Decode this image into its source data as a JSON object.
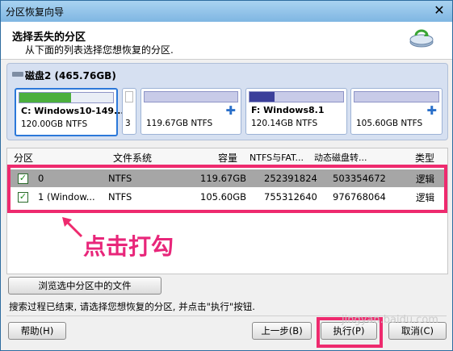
{
  "window": {
    "title": "分区恢复向导",
    "close_glyph": "✕"
  },
  "header": {
    "title": "选择丢失的分区",
    "subtitle": "从下面的列表选择您想恢复的分区."
  },
  "disk": {
    "label": "磁盘2 (465.76GB)",
    "partitions": [
      {
        "name": "C: Windows10-149...",
        "size": "120.00GB NTFS",
        "fill_fraction": 0.55,
        "fill_color": "#4caf3e",
        "selected": true
      },
      {
        "name": "",
        "size": "3",
        "fill_fraction": 0,
        "fill_color": "#ffffff",
        "selected": false
      },
      {
        "name": "",
        "size": "119.67GB NTFS",
        "fill_fraction": 0,
        "fill_color": "#3b3f9a",
        "selected": false,
        "plus": true
      },
      {
        "name": "F: Windows8.1",
        "size": "120.14GB NTFS",
        "fill_fraction": 0.27,
        "fill_color": "#3b3f9a",
        "selected": false
      },
      {
        "name": "",
        "size": "105.60GB NTFS",
        "fill_fraction": 0,
        "fill_color": "#3b3f9a",
        "selected": false,
        "plus": true
      }
    ]
  },
  "table": {
    "headers": [
      "分区",
      "文件系统",
      "容量",
      "NTFS与FAT...",
      "动态磁盘转...",
      "类型"
    ],
    "rows": [
      {
        "name": "0",
        "fs": "NTFS",
        "size": "119.67GB",
        "a": "252391824",
        "b": "503354672",
        "type": "逻辑",
        "checked": true
      },
      {
        "name": "1 (Window...",
        "fs": "NTFS",
        "size": "105.60GB",
        "a": "755312640",
        "b": "976768064",
        "type": "逻辑",
        "checked": true
      }
    ]
  },
  "annotation": {
    "text": "点击打勾",
    "color": "#ee2a6e"
  },
  "browse_button": "浏览选中分区中的文件",
  "status": "搜索过程已结束, 请选择您想恢复的分区, 并点击\"执行\"按钮.",
  "buttons": {
    "help": "帮助(H)",
    "back": "上一步(B)",
    "execute": "执行(P)",
    "cancel": "取消(C)"
  },
  "watermark": "jingyan.baidu.com"
}
